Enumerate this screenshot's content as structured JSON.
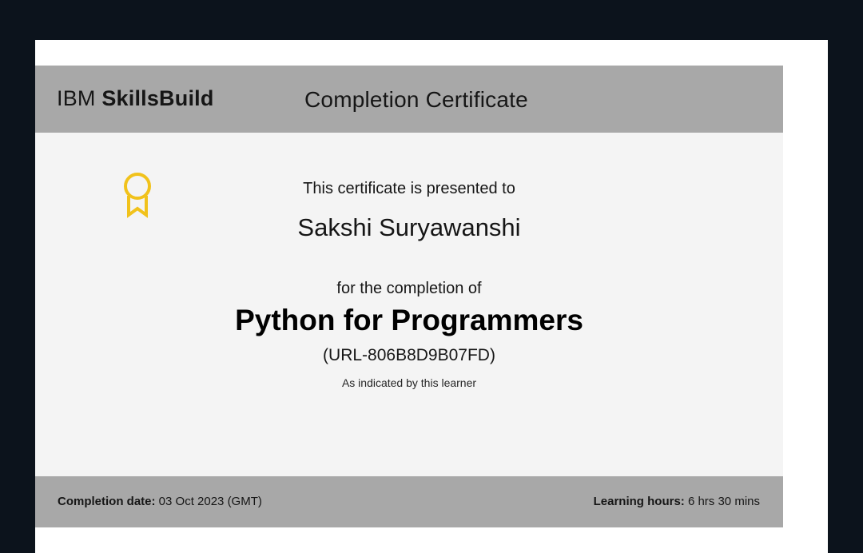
{
  "brand": {
    "prefix": "IBM",
    "name": "SkillsBuild"
  },
  "certificate": {
    "title": "Completion Certificate",
    "presented_text": "This certificate is presented to",
    "recipient": "Sakshi Suryawanshi",
    "completion_text": "for the completion of",
    "course_name": "Python for Programmers",
    "course_id": "(URL-806B8D9B07FD)",
    "note": "As indicated by this learner"
  },
  "footer": {
    "completion_date_label": "Completion date:",
    "completion_date_value": "03 Oct 2023 (GMT)",
    "learning_hours_label": "Learning hours:",
    "learning_hours_value": "6 hrs 30 mins"
  },
  "icons": {
    "badge": "award-ribbon-icon"
  },
  "colors": {
    "badge": "#f1c21b",
    "header_band": "#a8a8a8",
    "certificate_background": "#f4f4f4",
    "page_background": "#0c131c"
  }
}
